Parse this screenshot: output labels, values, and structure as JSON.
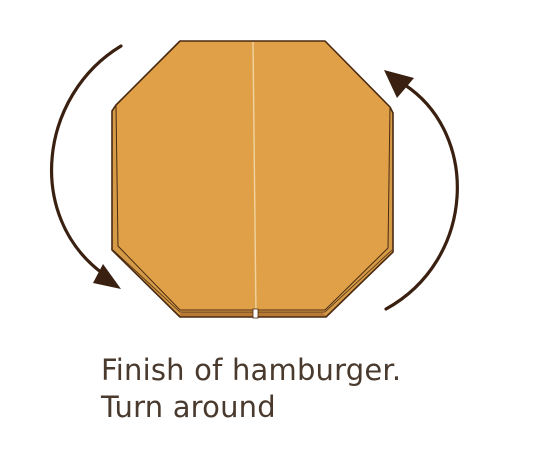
{
  "caption": {
    "line1": "Finish of hamburger.",
    "line2": "Turn around"
  },
  "colors": {
    "paper_face": "#E0A048",
    "paper_edge": "#D49A45",
    "paper_shadow": "#B87A35",
    "outline": "#4A2A12",
    "crease": "#F0D3A0",
    "arrow": "#3A2010",
    "caption_text": "#4A3A2E"
  },
  "icons": {
    "left_arrow": "curved-arrow-counterclockwise",
    "right_arrow": "curved-arrow-clockwise"
  }
}
